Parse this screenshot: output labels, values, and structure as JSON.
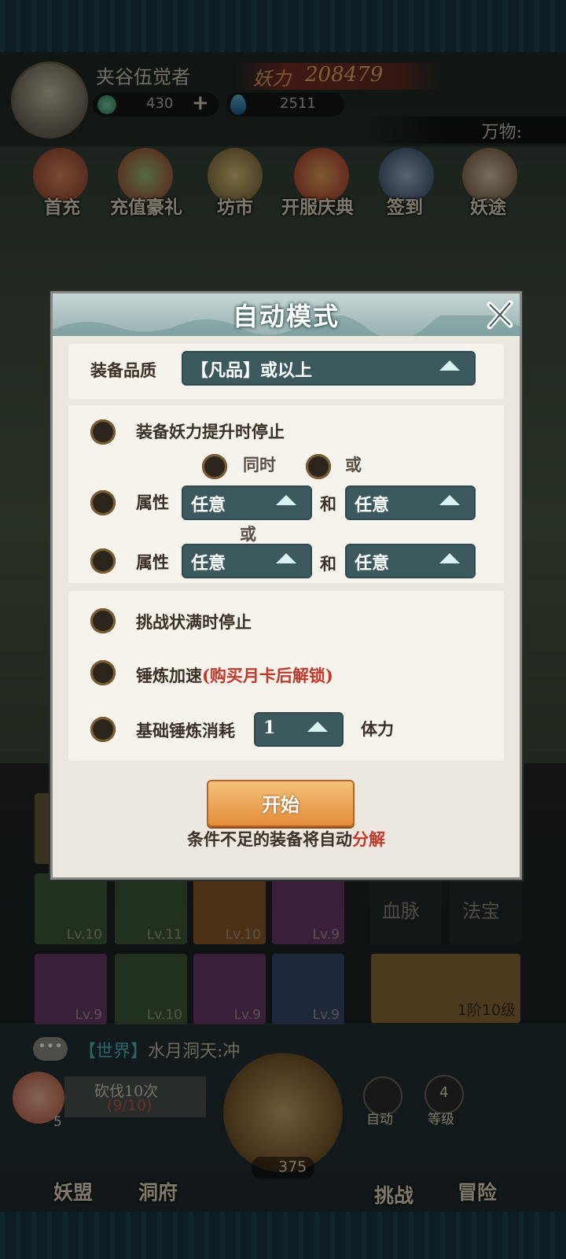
{
  "player": {
    "name": "夹谷伍觉者",
    "power_label": "妖力",
    "power_value": "208479"
  },
  "resources": {
    "jade": "430",
    "water": "2511"
  },
  "wanwu_label": "万物:",
  "top_menu": [
    "首充",
    "充值豪礼",
    "坊市",
    "开服庆典",
    "签到",
    "妖途"
  ],
  "modal": {
    "title": "自动模式",
    "quality_label": "装备品质",
    "quality_value": "【凡品】或以上",
    "stop_power_label": "装备妖力提升时停止",
    "mode_both": "同时",
    "mode_or": "或",
    "attr_label_1": "属性",
    "attr1_a": "任意",
    "and_1": "和",
    "attr1_b": "任意",
    "or_between": "或",
    "attr_label_2": "属性",
    "attr2_a": "任意",
    "and_2": "和",
    "attr2_b": "任意",
    "stop_challenge_label": "挑战状满时停止",
    "speed_label": "锤炼加速",
    "speed_locked": "(购买月卡后解锁)",
    "cost_label": "基础锤炼消耗",
    "cost_value": "1",
    "cost_unit": "体力",
    "start_button": "开始",
    "note_prefix": "条件不足的装备将自动",
    "note_action": "分解"
  },
  "inventory": {
    "row2": [
      "Lv.10",
      "Lv.11",
      "Lv.10",
      "Lv.9"
    ],
    "row3": [
      "Lv.9",
      "Lv.10",
      "Lv.9",
      "Lv.9"
    ],
    "side_labels": [
      "血脉",
      "法宝"
    ],
    "stage_label": "1阶10级"
  },
  "chat": {
    "icon": "•••",
    "channel": "【世界】",
    "message": "水月洞天:冲"
  },
  "chop": {
    "label": "砍伐10次",
    "progress": "(9/10)",
    "peach_count": "5",
    "coins": "375"
  },
  "auto_label": "自动",
  "level": {
    "value": "4",
    "label": "等级"
  },
  "bottom_nav": [
    "妖盟",
    "洞府",
    "挑战",
    "冒险"
  ],
  "colors": {
    "accent_red": "#c1392b",
    "select_bg": "#3c5a5e",
    "start_orange": "#e38d3b"
  }
}
